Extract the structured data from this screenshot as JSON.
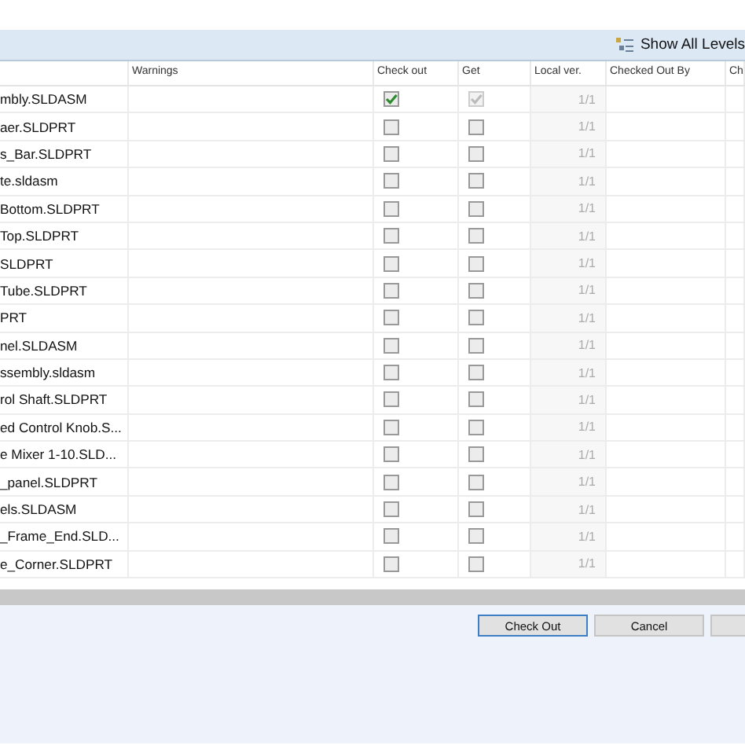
{
  "toolbar": {
    "show_all_levels": "Show All Levels"
  },
  "table": {
    "columns": [
      "Warnings",
      "Check out",
      "Get",
      "Local ver.",
      "Checked Out By",
      "Ch"
    ],
    "rows": [
      {
        "name": "mbly.SLDASM",
        "check_out": true,
        "get": true,
        "get_disabled": true,
        "local_ver": "1/1"
      },
      {
        "name": "aer.SLDPRT",
        "check_out": false,
        "get": false,
        "get_disabled": false,
        "local_ver": "1/1"
      },
      {
        "name": "s_Bar.SLDPRT",
        "check_out": false,
        "get": false,
        "get_disabled": false,
        "local_ver": "1/1"
      },
      {
        "name": "te.sldasm",
        "check_out": false,
        "get": false,
        "get_disabled": false,
        "local_ver": "1/1"
      },
      {
        "name": "Bottom.SLDPRT",
        "check_out": false,
        "get": false,
        "get_disabled": false,
        "local_ver": "1/1"
      },
      {
        "name": "Top.SLDPRT",
        "check_out": false,
        "get": false,
        "get_disabled": false,
        "local_ver": "1/1"
      },
      {
        "name": "SLDPRT",
        "check_out": false,
        "get": false,
        "get_disabled": false,
        "local_ver": "1/1"
      },
      {
        "name": "Tube.SLDPRT",
        "check_out": false,
        "get": false,
        "get_disabled": false,
        "local_ver": "1/1"
      },
      {
        "name": "PRT",
        "check_out": false,
        "get": false,
        "get_disabled": false,
        "local_ver": "1/1"
      },
      {
        "name": "nel.SLDASM",
        "check_out": false,
        "get": false,
        "get_disabled": false,
        "local_ver": "1/1"
      },
      {
        "name": "ssembly.sldasm",
        "check_out": false,
        "get": false,
        "get_disabled": false,
        "local_ver": "1/1"
      },
      {
        "name": "rol Shaft.SLDPRT",
        "check_out": false,
        "get": false,
        "get_disabled": false,
        "local_ver": "1/1"
      },
      {
        "name": "ed Control Knob.S...",
        "check_out": false,
        "get": false,
        "get_disabled": false,
        "local_ver": "1/1"
      },
      {
        "name": "e Mixer 1-10.SLD...",
        "check_out": false,
        "get": false,
        "get_disabled": false,
        "local_ver": "1/1"
      },
      {
        "name": "_panel.SLDPRT",
        "check_out": false,
        "get": false,
        "get_disabled": false,
        "local_ver": "1/1"
      },
      {
        "name": "els.SLDASM",
        "check_out": false,
        "get": false,
        "get_disabled": false,
        "local_ver": "1/1"
      },
      {
        "name": "_Frame_End.SLD...",
        "check_out": false,
        "get": false,
        "get_disabled": false,
        "local_ver": "1/1"
      },
      {
        "name": "e_Corner.SLDPRT",
        "check_out": false,
        "get": false,
        "get_disabled": false,
        "local_ver": "1/1"
      }
    ]
  },
  "buttons": [
    {
      "label": "Check Out",
      "default": true
    },
    {
      "label": "Cancel",
      "default": false
    },
    {
      "default": false
    }
  ]
}
